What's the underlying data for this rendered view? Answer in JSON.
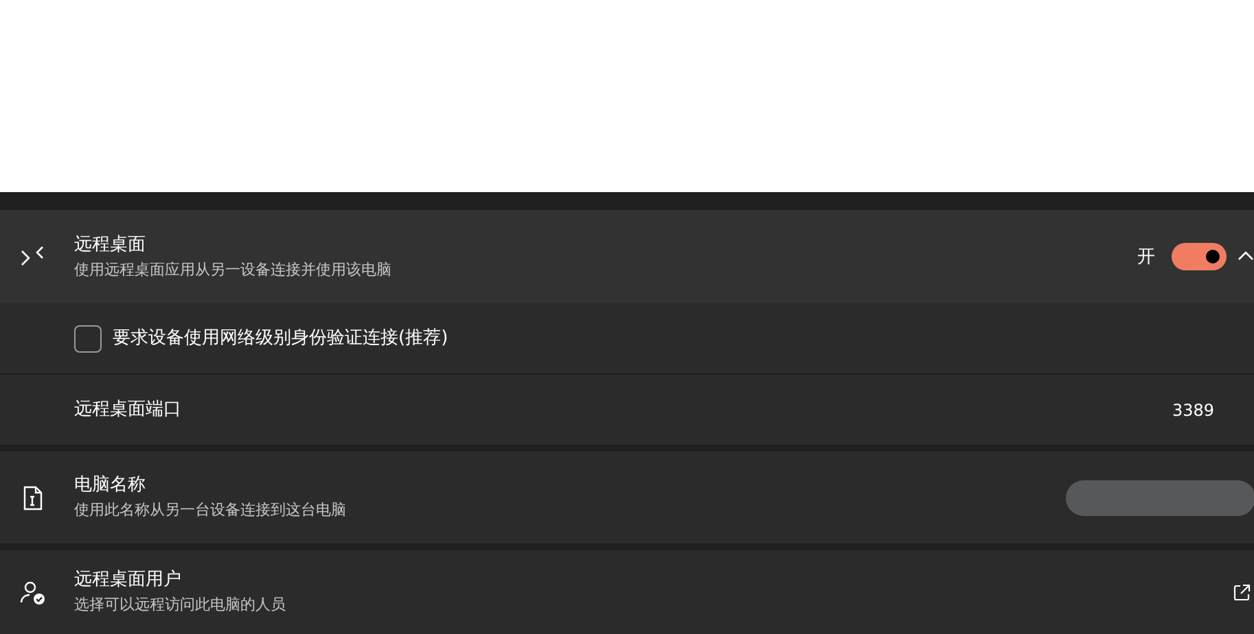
{
  "remote_desktop": {
    "title": "远程桌面",
    "subtitle": "使用远程桌面应用从另一设备连接并使用该电脑",
    "toggle_label": "开",
    "on": true,
    "expanded": true
  },
  "nla_option": {
    "label": "要求设备使用网络级别身份验证连接(推荐)",
    "checked": false
  },
  "port": {
    "label": "远程桌面端口",
    "value": "3389"
  },
  "pc_name": {
    "title": "电脑名称",
    "subtitle": "使用此名称从另一台设备连接到这台电脑"
  },
  "users": {
    "title": "远程桌面用户",
    "subtitle": "选择可以远程访问此电脑的人员"
  }
}
